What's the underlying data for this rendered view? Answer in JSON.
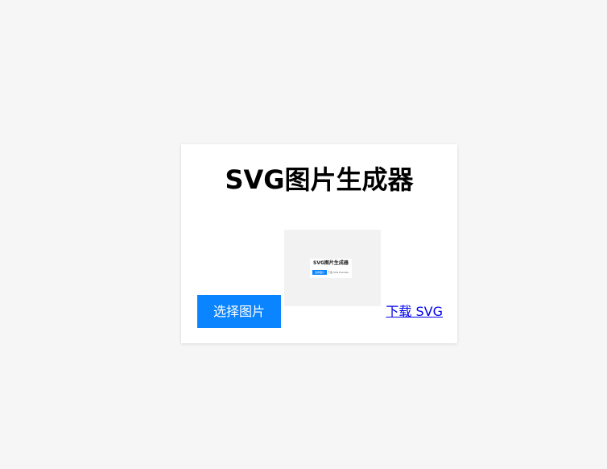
{
  "page": {
    "title": "SVG图片生成器"
  },
  "actions": {
    "select_label": "选择图片",
    "download_label": "下载 SVG"
  },
  "preview": {
    "mini_title": "SVG图片生成器",
    "mini_button": "选择图片",
    "mini_link": "下载 SVG Preview"
  },
  "colors": {
    "accent": "#0a84ff",
    "link": "#0000ee",
    "background": "#f6f6f6",
    "card": "#ffffff"
  }
}
